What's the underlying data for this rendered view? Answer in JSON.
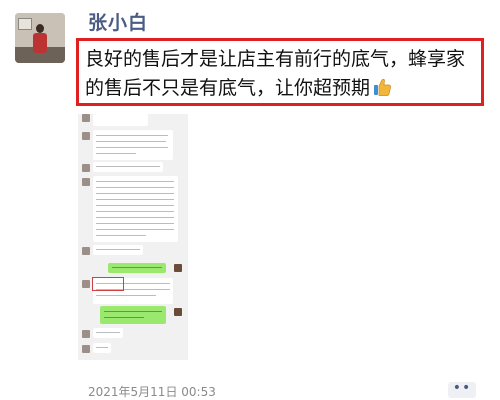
{
  "post": {
    "author": "张小白",
    "text": "良好的售后才是让店主有前行的底气，蜂享家的售后不只是有底气，让你超预期",
    "emoji_icon": "thumbs-up-icon",
    "timestamp": "2021年5月11日 00:53",
    "more_label": "••"
  },
  "colors": {
    "author": "#4a5b84",
    "highlight_border": "#e02020",
    "timestamp": "#8a8a8a",
    "green_bubble": "#9be86f"
  }
}
